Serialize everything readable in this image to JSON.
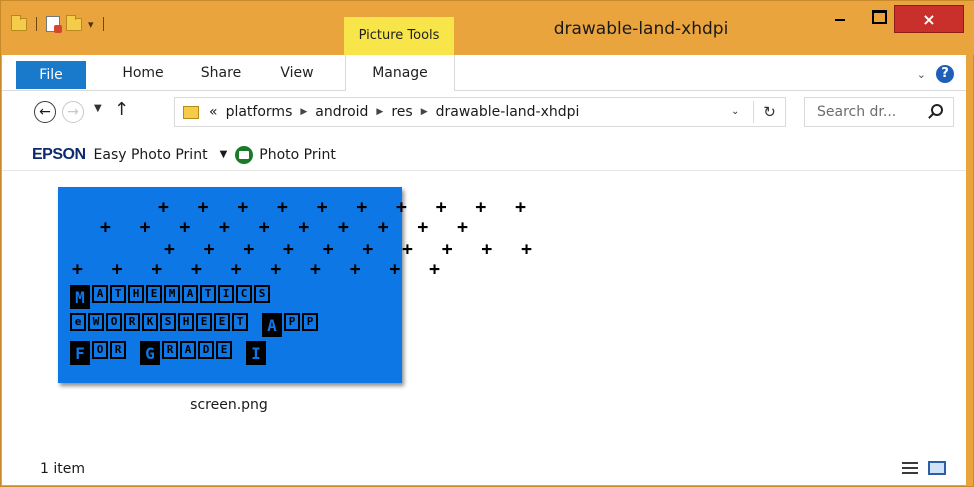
{
  "window": {
    "title": "drawable-land-xhdpi",
    "context_tab_group": "Picture Tools",
    "close_glyph": "×"
  },
  "ribbon": {
    "tabs": [
      "File",
      "Home",
      "Share",
      "View",
      "Manage"
    ],
    "active_context_tab": "Manage"
  },
  "address": {
    "overflow_glyph": "«",
    "breadcrumbs": [
      "platforms",
      "android",
      "res",
      "drawable-land-xhdpi"
    ],
    "search_placeholder": "Search dr..."
  },
  "toolbar": {
    "brand": "EPSON",
    "easy_photo_print": "Easy Photo Print",
    "photo_print": "Photo Print"
  },
  "files": [
    {
      "name": "screen.png",
      "thumbnail": {
        "background_color": "#0d77e6",
        "line1": "MATHEMATICS",
        "line2": "eWORKSHEET APP",
        "line3": "FOR GRADE I"
      }
    }
  ],
  "status": {
    "item_count": "1 item"
  },
  "colors": {
    "title_bar": "#e9a43d",
    "picture_tools_highlight": "#f7e54a",
    "file_tab": "#1979ca",
    "close_button": "#c9302c"
  }
}
